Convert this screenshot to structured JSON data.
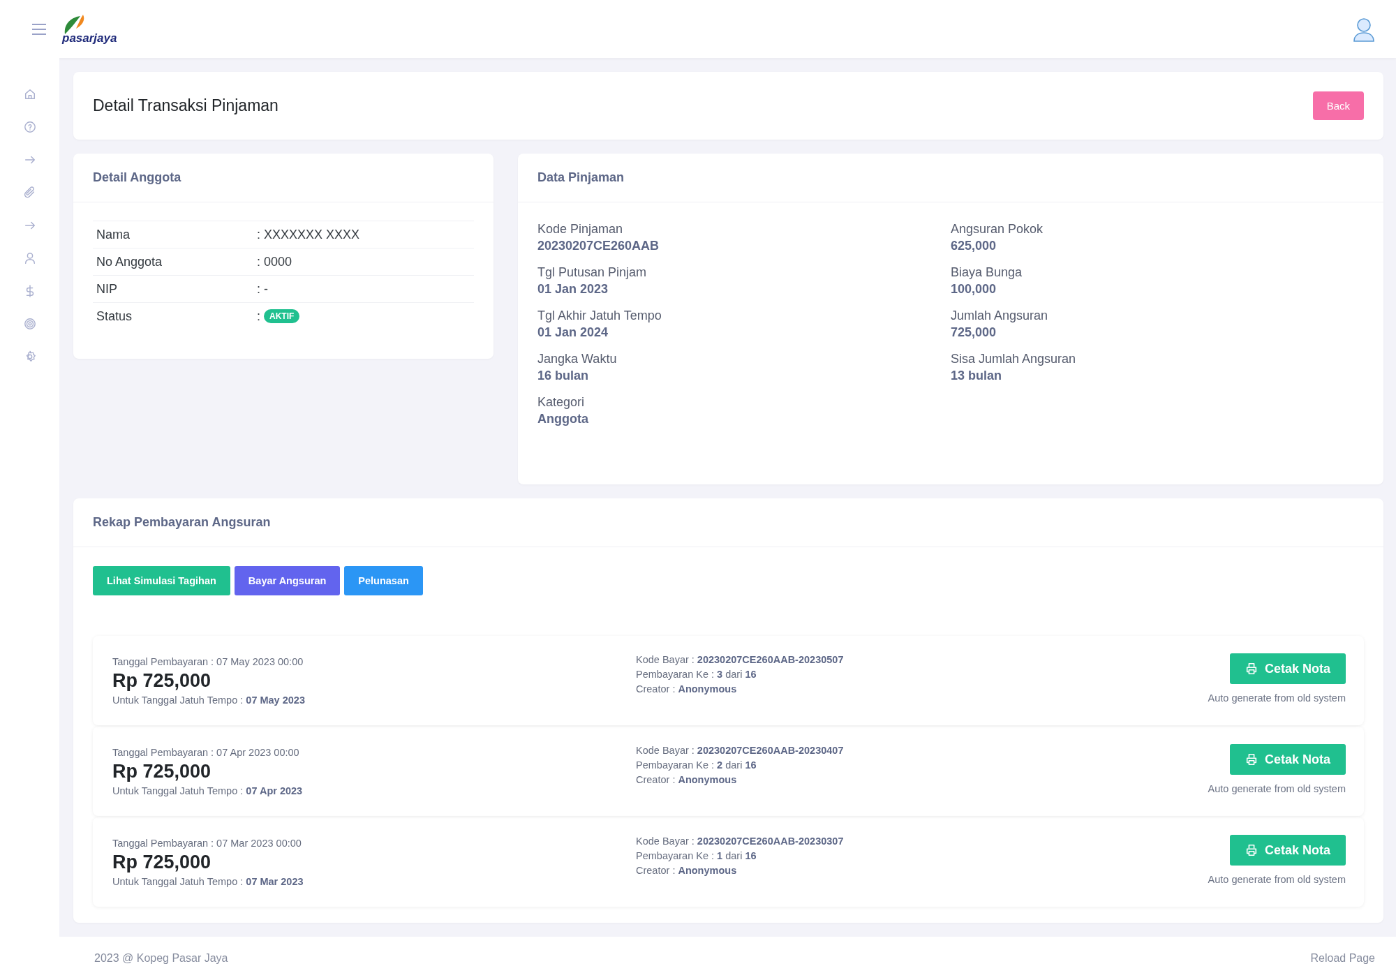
{
  "header": {
    "brand": "pasarjaya"
  },
  "page": {
    "title": "Detail Transaksi Pinjaman",
    "back_button": "Back"
  },
  "detail_anggota": {
    "title": "Detail Anggota",
    "rows": [
      {
        "label": "Nama",
        "separator": ":",
        "value": "XXXXXXX XXXX",
        "kind": "text"
      },
      {
        "label": "No Anggota",
        "separator": ":",
        "value": "0000",
        "kind": "text"
      },
      {
        "label": "NIP",
        "separator": ":",
        "value": "-",
        "kind": "text"
      },
      {
        "label": "Status",
        "separator": ":",
        "value": "AKTIF",
        "kind": "badge"
      }
    ]
  },
  "data_pinjaman": {
    "title": "Data Pinjaman",
    "columns": [
      [
        {
          "label": "Kode Pinjaman",
          "value": "20230207CE260AAB"
        },
        {
          "label": "Tgl Putusan Pinjam",
          "value": "01 Jan 2023"
        },
        {
          "label": "Tgl Akhir Jatuh Tempo",
          "value": "01 Jan 2024"
        },
        {
          "label": "Jangka Waktu",
          "value": "16 bulan"
        },
        {
          "label": "Kategori",
          "value": "Anggota"
        }
      ],
      [
        {
          "label": "Angsuran Pokok",
          "value": "625,000"
        },
        {
          "label": "Biaya Bunga",
          "value": "100,000"
        },
        {
          "label": "Jumlah Angsuran",
          "value": "725,000"
        },
        {
          "label": "Sisa Jumlah Angsuran",
          "value": "13 bulan"
        }
      ]
    ]
  },
  "rekap": {
    "title": "Rekap Pembayaran Angsuran",
    "buttons": [
      {
        "label": "Lihat Simulasi Tagihan",
        "kind": "success"
      },
      {
        "label": "Bayar Angsuran",
        "kind": "primary"
      },
      {
        "label": "Pelunasan",
        "kind": "info"
      }
    ],
    "payments": [
      {
        "tanggal": "Tanggal Pembayaran : 07 May 2023 00:00",
        "amount": "Rp 725,000",
        "jatuh_tempo": "Untuk Tanggal Jatuh Tempo : **07 May 2023**",
        "kode": "Kode Bayar : **20230207CE260AAB-20230507**",
        "ke": "Pembayaran Ke : **3** dari **16**",
        "creator": "Creator : **Anonymous**",
        "button": "Cetak Nota",
        "note": "Auto generate from old system"
      },
      {
        "tanggal": "Tanggal Pembayaran : 07 Apr 2023 00:00",
        "amount": "Rp 725,000",
        "jatuh_tempo": "Untuk Tanggal Jatuh Tempo : **07 Apr 2023**",
        "kode": "Kode Bayar : **20230207CE260AAB-20230407**",
        "ke": "Pembayaran Ke : **2** dari **16**",
        "creator": "Creator : **Anonymous**",
        "button": "Cetak Nota",
        "note": "Auto generate from old system"
      },
      {
        "tanggal": "Tanggal Pembayaran : 07 Mar 2023 00:00",
        "amount": "Rp 725,000",
        "jatuh_tempo": "Untuk Tanggal Jatuh Tempo : **07 Mar 2023**",
        "kode": "Kode Bayar : **20230207CE260AAB-20230307**",
        "ke": "Pembayaran Ke : **1** dari **16**",
        "creator": "Creator : **Anonymous**",
        "button": "Cetak Nota",
        "note": "Auto generate from old system"
      }
    ]
  },
  "footer": {
    "copyright": "2023 @ Kopeg Pasar Jaya",
    "link": "Reload Page"
  }
}
